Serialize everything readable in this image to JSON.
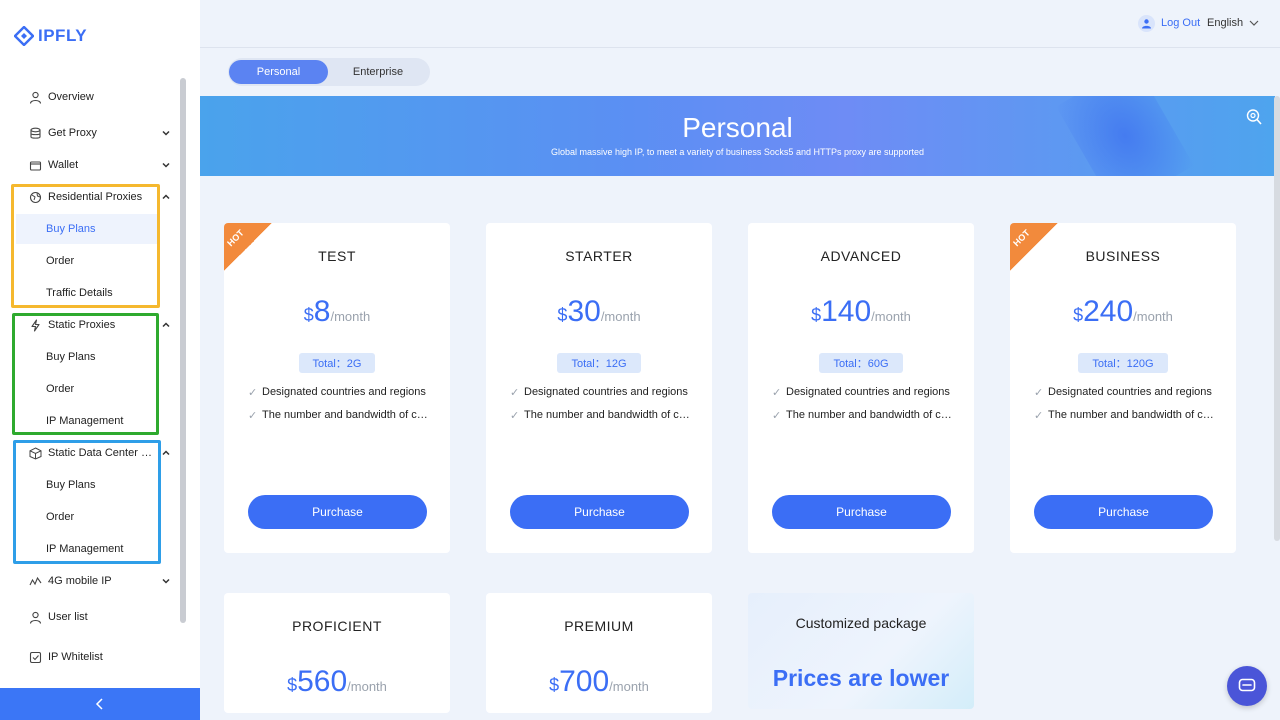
{
  "brand": {
    "name": "IPFLY"
  },
  "sidebar": {
    "items": [
      {
        "label": "Overview",
        "icon": "user-icon"
      },
      {
        "label": "Get Proxy",
        "icon": "database-icon"
      },
      {
        "label": "Wallet",
        "icon": "wallet-icon"
      },
      {
        "label": "Residential Proxies",
        "icon": "globe-icon"
      },
      {
        "label": "Static Proxies",
        "icon": "lightning-icon"
      },
      {
        "label": "Static Data Center Proxies",
        "icon": "cube-icon"
      },
      {
        "label": "4G mobile IP",
        "icon": "signal-icon"
      },
      {
        "label": "User list",
        "icon": "user-icon"
      },
      {
        "label": "IP Whitelist",
        "icon": "shield-icon"
      }
    ],
    "residential_sub": [
      "Buy Plans",
      "Order",
      "Traffic Details"
    ],
    "static_sub": [
      "Buy Plans",
      "Order",
      "IP Management"
    ],
    "datacenter_sub": [
      "Buy Plans",
      "Order",
      "IP Management"
    ],
    "box_colors": {
      "residential": "#f5b82e",
      "static": "#2eaa2e",
      "datacenter": "#2e9ee8"
    }
  },
  "header": {
    "logout": "Log Out",
    "language": "English"
  },
  "tabs": {
    "personal": "Personal",
    "enterprise": "Enterprise"
  },
  "banner": {
    "title": "Personal",
    "subtitle": "Global massive high IP, to meet a variety of business Socks5 and HTTPs proxy are supported"
  },
  "plans": [
    {
      "name": "TEST",
      "currency": "$",
      "price": "8",
      "per": "/month",
      "total": "Total：2G",
      "hot": true
    },
    {
      "name": "STARTER",
      "currency": "$",
      "price": "30",
      "per": "/month",
      "total": "Total：12G",
      "hot": false
    },
    {
      "name": "ADVANCED",
      "currency": "$",
      "price": "140",
      "per": "/month",
      "total": "Total：60G",
      "hot": false
    },
    {
      "name": "BUSINESS",
      "currency": "$",
      "price": "240",
      "per": "/month",
      "total": "Total：120G",
      "hot": true
    },
    {
      "name": "PROFICIENT",
      "currency": "$",
      "price": "560",
      "per": "/month"
    },
    {
      "name": "PREMIUM",
      "currency": "$",
      "price": "700",
      "per": "/month"
    }
  ],
  "plan_labels": {
    "hot": "HOT",
    "feature_1": "Designated countries and regions",
    "feature_2": "The number and bandwidth of connections",
    "purchase": "Purchase"
  },
  "custom": {
    "title": "Customized package",
    "subtitle": "Prices are lower"
  },
  "colors": {
    "accent": "#3b6ef5",
    "hot": "#f28a3c",
    "collapse_bar": "#3b76f6"
  }
}
